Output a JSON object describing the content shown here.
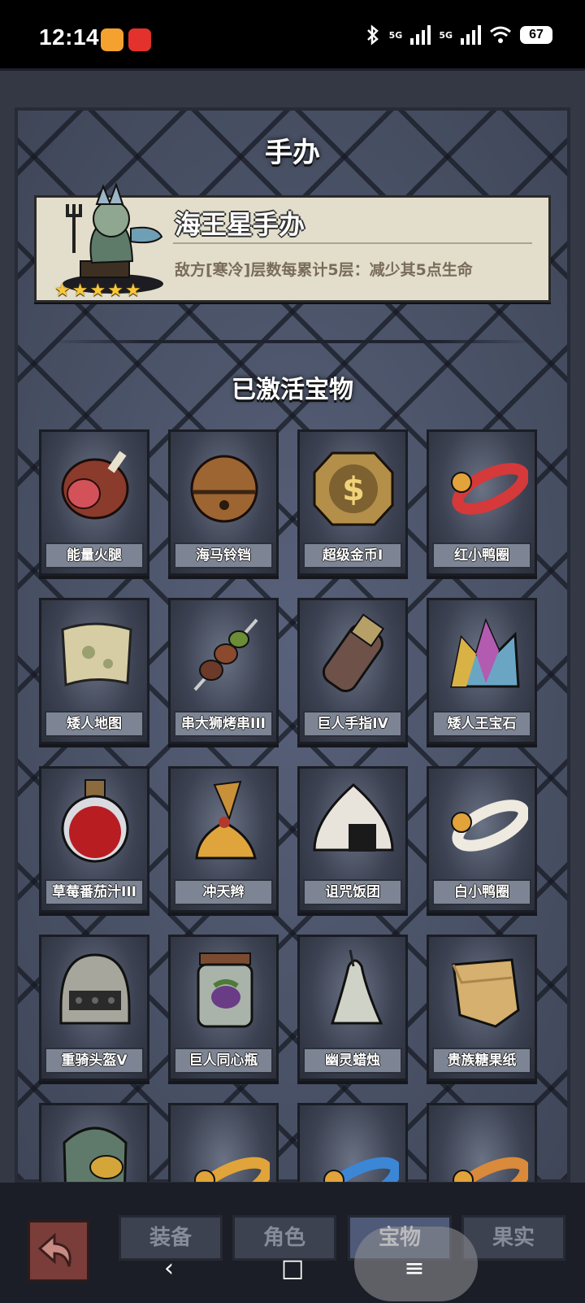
{
  "status": {
    "time": "12:14",
    "network1": "5G",
    "network2": "5G",
    "battery": "67"
  },
  "panel": {
    "title": "手办",
    "figure": {
      "name": "海王星手办",
      "description": "敌方[寒冷]层数每累计5层：减少其5点生命",
      "stars": 5
    },
    "section_title": "已激活宝物"
  },
  "items": [
    {
      "label": "能量火腿",
      "icon": "ham-icon"
    },
    {
      "label": "海马铃铛",
      "icon": "bell-icon"
    },
    {
      "label": "超级金币I",
      "icon": "gold-coin-icon"
    },
    {
      "label": "红小鸭圈",
      "icon": "red-duck-ring-icon"
    },
    {
      "label": "矮人地图",
      "icon": "map-icon"
    },
    {
      "label": "串大狮烤串III",
      "icon": "skewer-icon"
    },
    {
      "label": "巨人手指IV",
      "icon": "giant-finger-icon"
    },
    {
      "label": "矮人王宝石",
      "icon": "gem-icon"
    },
    {
      "label": "草莓番茄汁III",
      "icon": "potion-icon"
    },
    {
      "label": "冲天辫",
      "icon": "braid-icon"
    },
    {
      "label": "诅咒饭团",
      "icon": "rice-ball-icon"
    },
    {
      "label": "白小鸭圈",
      "icon": "white-duck-ring-icon"
    },
    {
      "label": "重骑头盔V",
      "icon": "helmet-icon"
    },
    {
      "label": "巨人同心瓶",
      "icon": "jar-icon"
    },
    {
      "label": "幽灵蜡烛",
      "icon": "candle-icon"
    },
    {
      "label": "贵族糖果纸",
      "icon": "candy-paper-icon"
    },
    {
      "label": "",
      "icon": "mask-icon"
    },
    {
      "label": "",
      "icon": "yellow-duck-ring-icon"
    },
    {
      "label": "",
      "icon": "blue-duck-ring-icon"
    },
    {
      "label": "",
      "icon": "orange-duck-ring-icon"
    }
  ],
  "tabs": [
    {
      "label": "装备",
      "active": false
    },
    {
      "label": "角色",
      "active": false
    },
    {
      "label": "宝物",
      "active": true
    },
    {
      "label": "果实",
      "active": false
    }
  ],
  "nav": {
    "back": "‹",
    "home": "□",
    "menu": "≡"
  }
}
